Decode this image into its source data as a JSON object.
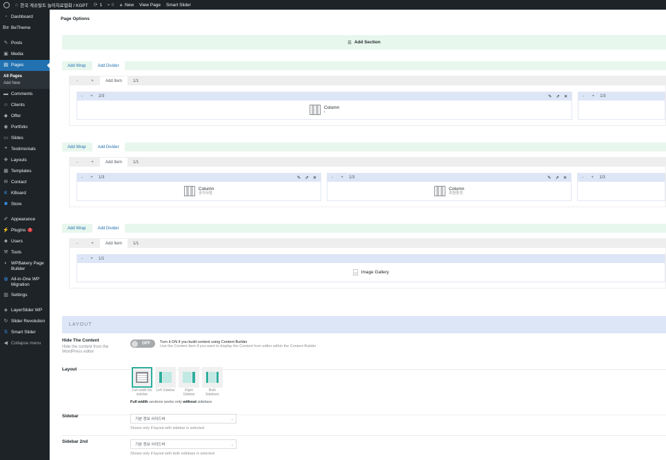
{
  "adminbar": {
    "site_name": "한국 게슈탈트 놀이치료협회 / KGPT",
    "updates_count": "1",
    "comments_count": "0",
    "new_label": "New",
    "view_page_label": "View Page",
    "smart_slider_label": "Smart Slider"
  },
  "sidebar": {
    "dashboard": "Dashboard",
    "betheme": "BeTheme",
    "posts": "Posts",
    "media": "Media",
    "pages": "Pages",
    "all_pages": "All Pages",
    "add_new": "Add New",
    "comments": "Comments",
    "clients": "Clients",
    "offer": "Offer",
    "portfolio": "Portfolio",
    "slides": "Slides",
    "testimonials": "Testimonials",
    "layouts": "Layouts",
    "templates": "Templates",
    "contact": "Contact",
    "kboard": "KBoard",
    "store": "Store",
    "appearance": "Appearance",
    "plugins": "Plugins",
    "plugins_badge": "1",
    "users": "Users",
    "tools": "Tools",
    "wpbakery": "WPBakery Page Builder",
    "allinone": "All-in-One WP Migration",
    "settings": "Settings",
    "layerslider": "LayerSlider WP",
    "slider_revolution": "Slider Revolution",
    "smart_slider": "Smart Slider",
    "collapse": "Collapse menu"
  },
  "builder": {
    "title": "Page Options",
    "add_section": "Add Section",
    "add_wrap": "Add Wrap",
    "add_divider": "Add Divider",
    "add_item": "Add Item",
    "minus": "-",
    "plus": "+",
    "wrap_size": "1/1",
    "section1": {
      "items": [
        {
          "size": "2/3",
          "title": "Column",
          "sub": "t"
        },
        {
          "size": "1/3",
          "title": "",
          "sub": ""
        }
      ]
    },
    "section2": {
      "items": [
        {
          "size": "1/3",
          "title": "Column",
          "sub": "공지사항"
        },
        {
          "size": "1/3",
          "title": "Column",
          "sub": "회원동정"
        },
        {
          "size": "1/3",
          "title": "",
          "sub": ""
        }
      ]
    },
    "section3": {
      "items": [
        {
          "size": "1/1",
          "title": "Image Gallery",
          "sub": ""
        }
      ]
    }
  },
  "layout_settings": {
    "header": "LAYOUT",
    "hide_content": {
      "label": "Hide The Content",
      "desc": "Hide the content from the WordPress editor",
      "toggle": "OFF",
      "info": "Turn it ON if you build content using Content Builder",
      "info_sub": "Use the Content Item if you want to display the Content from editor within the Content Builder"
    },
    "layout": {
      "label": "Layout",
      "options": [
        {
          "label": "Full width No sidebar",
          "selected": true
        },
        {
          "label": "Left Sidebar",
          "selected": false
        },
        {
          "label": "Right Sidebar",
          "selected": false
        },
        {
          "label": "Both Sidebars",
          "selected": false
        }
      ],
      "note_b1": "Full width",
      "note_mid": " sections works only ",
      "note_b2": "without",
      "note_end": " sidebars"
    },
    "sidebar": {
      "label": "Sidebar",
      "value": "기본 정보 사이드바",
      "note": "Shows only if layout with sidebar is selected"
    },
    "sidebar2": {
      "label": "Sidebar 2nd",
      "value": "기본 정보 사이드바",
      "note": "Shows only if layout with both sidebars is selected"
    }
  }
}
